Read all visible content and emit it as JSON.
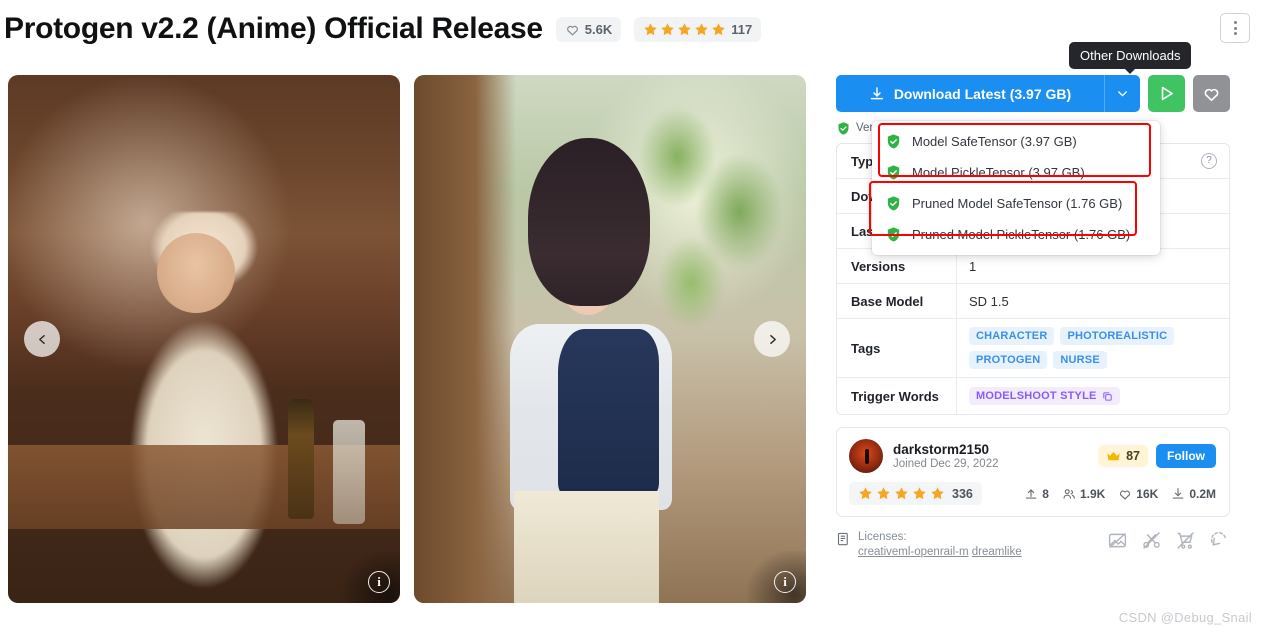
{
  "header": {
    "title": "Protogen v2.2 (Anime) Official Release",
    "like_count": "5.6K",
    "review_count": "117",
    "star_count": 5,
    "menu_icon": "dots-vertical-icon",
    "heart_icon": "heart-outline-icon"
  },
  "gallery": {
    "prev_icon": "chevron-left-icon",
    "next_icon": "chevron-right-icon",
    "info_icon": "info-circle-icon",
    "info_glyph": "i",
    "images": [
      {
        "alt": "nurse character in wood interior"
      },
      {
        "alt": "anime girl in sunlit alley"
      }
    ]
  },
  "actions": {
    "download_label": "Download Latest (3.97 GB)",
    "download_icon": "download-icon",
    "caret_icon": "chevron-down-icon",
    "run_icon": "play-triangle-icon",
    "favorite_icon": "heart-outline-icon",
    "tooltip": "Other Downloads",
    "accent_blue": "#1b8ef2",
    "run_green": "#40c463",
    "fav_gray": "#909296"
  },
  "verified": {
    "icon": "shield-check-icon",
    "text": "Ver"
  },
  "dropdown": {
    "items": [
      {
        "label": "Model SafeTensor (3.97 GB)",
        "icon": "shield-check-icon"
      },
      {
        "label": "Model PickleTensor (3.97 GB)",
        "icon": "shield-check-icon"
      },
      {
        "label": "Pruned Model SafeTensor (1.76 GB)",
        "icon": "shield-check-icon"
      },
      {
        "label": "Pruned Model PickleTensor (1.76 GB)",
        "icon": "shield-check-icon"
      }
    ],
    "highlight_color": "#ff0000"
  },
  "info_table": {
    "rows": [
      {
        "label": "Typ",
        "value": "",
        "help": "?"
      },
      {
        "label": "Dow",
        "value": ""
      },
      {
        "label": "Last",
        "value": ""
      },
      {
        "label": "Versions",
        "value": "1"
      },
      {
        "label": "Base Model",
        "value": "SD 1.5"
      }
    ],
    "tags_label": "Tags",
    "tags": [
      "CHARACTER",
      "PHOTOREALISTIC",
      "PROTOGEN",
      "NURSE"
    ],
    "trigger_label": "Trigger Words",
    "trigger_words": "MODELSHOOT STYLE",
    "copy_icon": "copy-icon"
  },
  "creator": {
    "name": "darkstorm2150",
    "joined": "Joined Dec 29, 2022",
    "crown_icon": "crown-icon",
    "crown_count": "87",
    "follow_label": "Follow",
    "rating_count": "336",
    "stats": [
      {
        "icon": "upload-icon",
        "value": "8"
      },
      {
        "icon": "users-icon",
        "value": "1.9K"
      },
      {
        "icon": "heart-outline-icon",
        "value": "16K"
      },
      {
        "icon": "download-icon",
        "value": "0.2M"
      }
    ]
  },
  "licenses": {
    "icon": "license-doc-icon",
    "label": "Licenses:",
    "links": [
      "creativeml-openrail-m",
      "dreamlike"
    ],
    "marks": [
      {
        "icon": "no-image-icon"
      },
      {
        "icon": "no-remix-icon"
      },
      {
        "icon": "no-sell-icon"
      },
      {
        "icon": "share-alike-icon"
      }
    ]
  },
  "watermark": "CSDN @Debug_Snail"
}
